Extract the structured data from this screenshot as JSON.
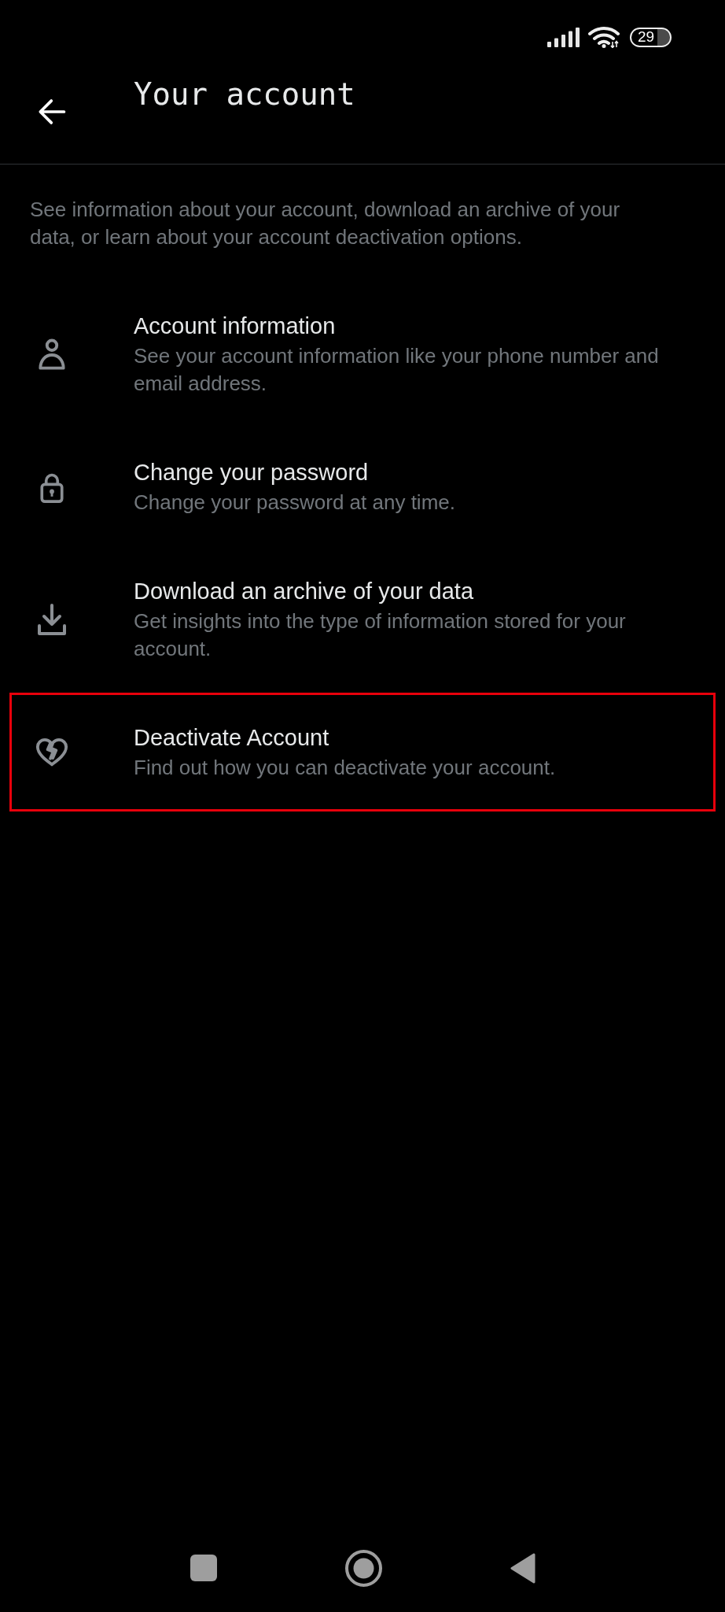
{
  "status_bar": {
    "battery": "29"
  },
  "header": {
    "title": "Your account"
  },
  "description": "See information about your account, download an archive of your data, or learn about your account deactivation options.",
  "items": [
    {
      "kind": "account",
      "title": "Account information",
      "subtitle": "See your account information like your phone number and email address.",
      "highlighted": false
    },
    {
      "kind": "password",
      "title": "Change your password",
      "subtitle": "Change your password at any time.",
      "highlighted": false
    },
    {
      "kind": "archive",
      "title": "Download an archive of your data",
      "subtitle": "Get insights into the type of information stored for your account.",
      "highlighted": false
    },
    {
      "kind": "deactivate",
      "title": "Deactivate Account",
      "subtitle": "Find out how you can deactivate your account.",
      "highlighted": true
    }
  ]
}
